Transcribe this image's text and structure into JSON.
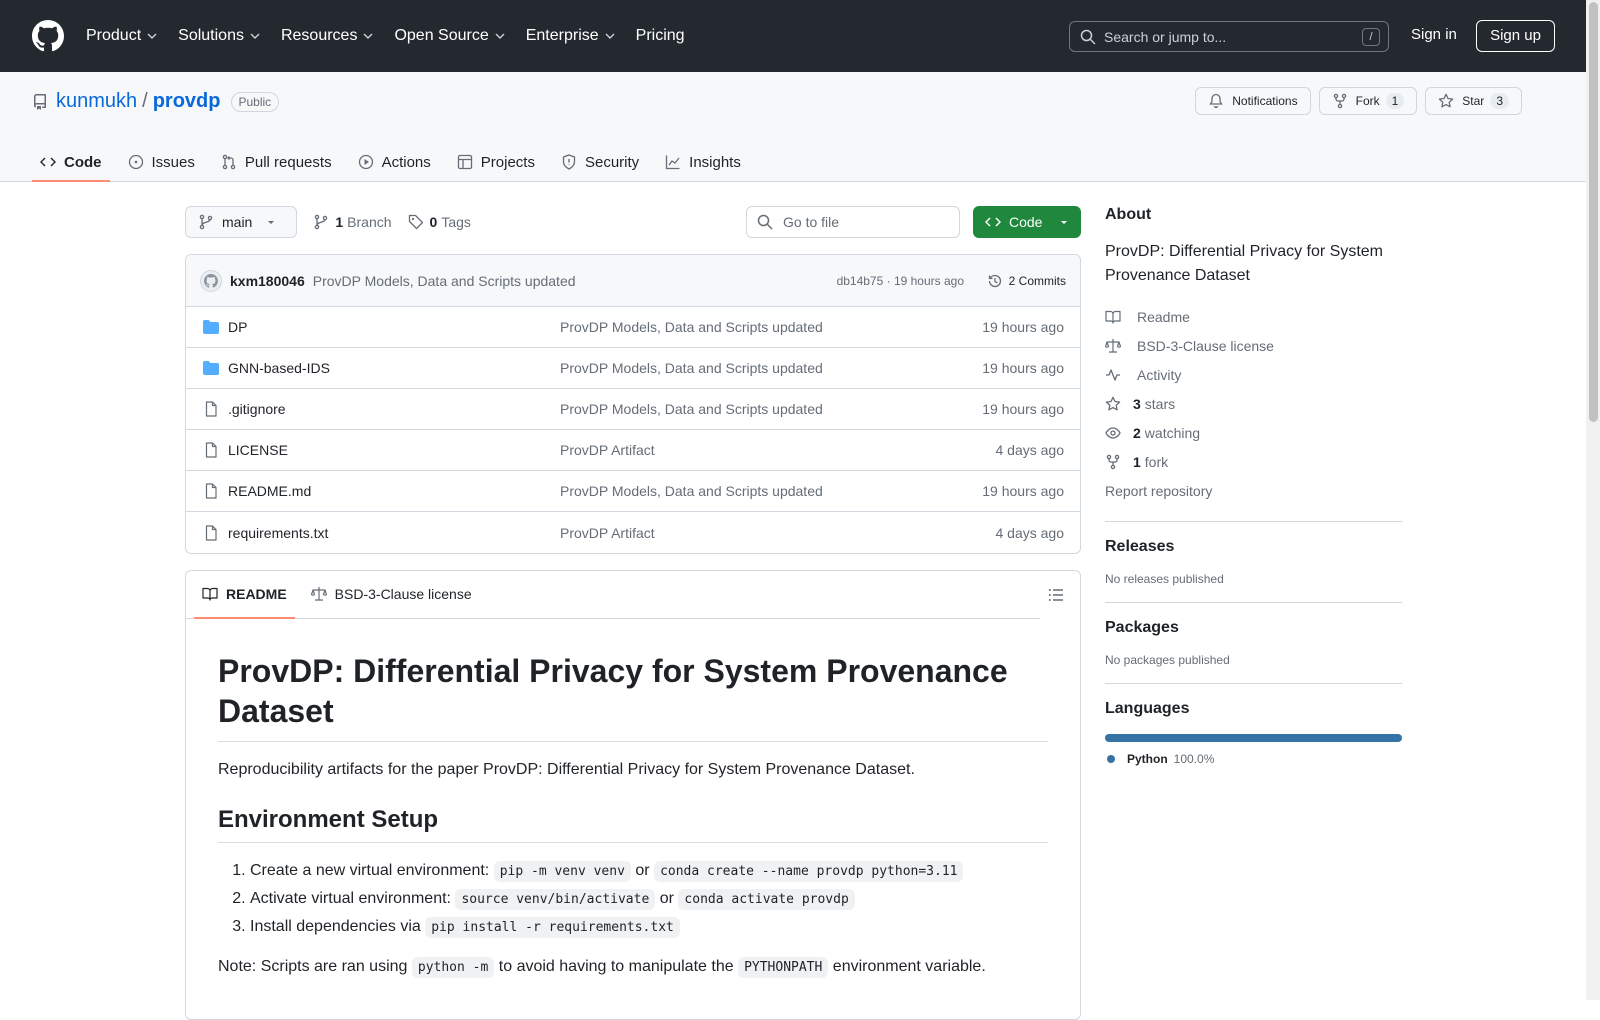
{
  "header": {
    "nav": [
      {
        "label": "Product",
        "dropdown": true
      },
      {
        "label": "Solutions",
        "dropdown": true
      },
      {
        "label": "Resources",
        "dropdown": true
      },
      {
        "label": "Open Source",
        "dropdown": true
      },
      {
        "label": "Enterprise",
        "dropdown": true
      },
      {
        "label": "Pricing",
        "dropdown": false
      }
    ],
    "search_placeholder": "Search or jump to...",
    "search_shortcut": "/",
    "sign_in": "Sign in",
    "sign_up": "Sign up"
  },
  "repo": {
    "owner": "kunmukh",
    "separator": "/",
    "name": "provdp",
    "visibility": "Public",
    "notifications_label": "Notifications",
    "fork_label": "Fork",
    "fork_count": "1",
    "star_label": "Star",
    "star_count": "3"
  },
  "tabs": [
    {
      "label": "Code",
      "icon": "code-icon",
      "active": true
    },
    {
      "label": "Issues",
      "icon": "issue-icon"
    },
    {
      "label": "Pull requests",
      "icon": "pull-request-icon"
    },
    {
      "label": "Actions",
      "icon": "play-icon"
    },
    {
      "label": "Projects",
      "icon": "table-icon"
    },
    {
      "label": "Security",
      "icon": "shield-icon"
    },
    {
      "label": "Insights",
      "icon": "graph-icon"
    }
  ],
  "toolbar": {
    "branch": "main",
    "branch_count": "1",
    "branch_label": "Branch",
    "tag_count": "0",
    "tag_label": "Tags",
    "go_to_file": "Go to file",
    "code_button": "Code"
  },
  "latest_commit": {
    "author": "kxm180046",
    "message": "ProvDP Models, Data and Scripts updated",
    "sha_time": "db14b75 · 19 hours ago",
    "commits_label": "2 Commits"
  },
  "files": [
    {
      "name": "DP",
      "type": "folder",
      "message": "ProvDP Models, Data and Scripts updated",
      "date": "19 hours ago"
    },
    {
      "name": "GNN-based-IDS",
      "type": "folder",
      "message": "ProvDP Models, Data and Scripts updated",
      "date": "19 hours ago"
    },
    {
      "name": ".gitignore",
      "type": "file",
      "message": "ProvDP Models, Data and Scripts updated",
      "date": "19 hours ago"
    },
    {
      "name": "LICENSE",
      "type": "file",
      "message": "ProvDP Artifact",
      "date": "4 days ago"
    },
    {
      "name": "README.md",
      "type": "file",
      "message": "ProvDP Models, Data and Scripts updated",
      "date": "19 hours ago"
    },
    {
      "name": "requirements.txt",
      "type": "file",
      "message": "ProvDP Artifact",
      "date": "4 days ago"
    }
  ],
  "readme_tabs": {
    "readme": "README",
    "license": "BSD-3-Clause license"
  },
  "readme": {
    "title": "ProvDP: Differential Privacy for System Provenance Dataset",
    "intro": "Reproducibility artifacts for the paper ProvDP: Differential Privacy for System Provenance Dataset.",
    "env_heading": "Environment Setup",
    "steps": [
      {
        "text": "Create a new virtual environment:",
        "code1": "pip -m venv venv",
        "joiner": "or",
        "code2": "conda create --name provdp python=3.11"
      },
      {
        "text": "Activate virtual environment:",
        "code1": "source venv/bin/activate",
        "joiner": "or",
        "code2": "conda activate provdp"
      },
      {
        "text": "Install dependencies via",
        "code1": "pip install -r requirements.txt",
        "joiner": "",
        "code2": ""
      }
    ],
    "note_pre": "Note: Scripts are ran using",
    "note_code1": "python -m",
    "note_mid": "to avoid having to manipulate the",
    "note_code2": "PYTHONPATH",
    "note_post": "environment variable."
  },
  "sidebar": {
    "about_heading": "About",
    "description": "ProvDP: Differential Privacy for System Provenance Dataset",
    "links": [
      {
        "icon": "book-icon",
        "bold": "",
        "label": "Readme"
      },
      {
        "icon": "law-icon",
        "bold": "",
        "label": "BSD-3-Clause license"
      },
      {
        "icon": "pulse-icon",
        "bold": "",
        "label": "Activity"
      },
      {
        "icon": "star-icon",
        "bold": "3",
        "label": "stars"
      },
      {
        "icon": "eye-icon",
        "bold": "2",
        "label": "watching"
      },
      {
        "icon": "fork-icon",
        "bold": "1",
        "label": "fork"
      }
    ],
    "report": "Report repository",
    "releases_heading": "Releases",
    "releases_text": "No releases published",
    "packages_heading": "Packages",
    "packages_text": "No packages published",
    "languages_heading": "Languages",
    "language_name": "Python",
    "language_pct": "100.0%",
    "language_color": "#3572a5"
  }
}
